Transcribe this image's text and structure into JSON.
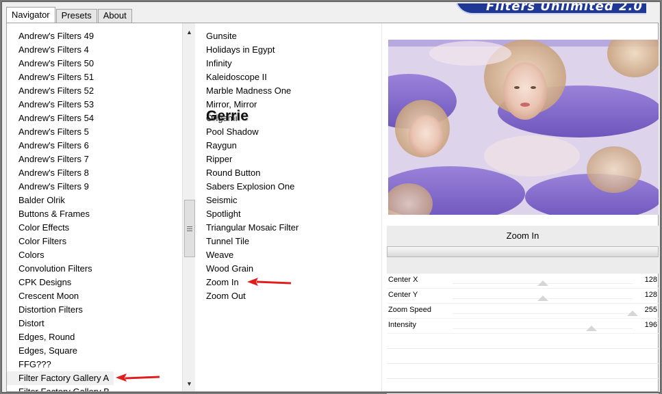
{
  "tabs": [
    {
      "label": "Navigator",
      "active": true
    },
    {
      "label": "Presets",
      "active": false
    },
    {
      "label": "About",
      "active": false
    }
  ],
  "logo_text": "Filters Unlimited 2.0",
  "category_list": {
    "items": [
      "Andrew's Filters 49",
      "Andrew's Filters 4",
      "Andrew's Filters 50",
      "Andrew's Filters 51",
      "Andrew's Filters 52",
      "Andrew's Filters 53",
      "Andrew's Filters 54",
      "Andrew's Filters 5",
      "Andrew's Filters 6",
      "Andrew's Filters 7",
      "Andrew's Filters 8",
      "Andrew's Filters 9",
      "Balder Olrik",
      "Buttons & Frames",
      "Color Effects",
      "Color Filters",
      "Colors",
      "Convolution Filters",
      "CPK Designs",
      "Crescent Moon",
      "Distortion Filters",
      "Distort",
      "Edges, Round",
      "Edges, Square",
      "FFG???",
      "Filter Factory Gallery A",
      "Filter Factory Gallery B"
    ],
    "selected": "Filter Factory Gallery A"
  },
  "filter_list": {
    "items": [
      "Gunsite",
      "Holidays in Egypt",
      "Infinity",
      "Kaleidoscope II",
      "Marble Madness One",
      "Mirror, Mirror",
      "Origami",
      "Pool Shadow",
      "Raygun",
      "Ripper",
      "Round Button",
      "Sabers Explosion One",
      "Seismic",
      "Spotlight",
      "Triangular Mosaic Filter",
      "Tunnel Tile",
      "Weave",
      "Wood Grain",
      "Zoom In",
      "Zoom Out"
    ],
    "selected": "Zoom In"
  },
  "watermark": "Gerrie",
  "selected_filter_name": "Zoom In",
  "parameters": [
    {
      "label": "Center X",
      "value": "128",
      "level": 0.5
    },
    {
      "label": "Center Y",
      "value": "128",
      "level": 0.5
    },
    {
      "label": "Zoom Speed",
      "value": "255",
      "level": 1.0
    },
    {
      "label": "Intensity",
      "value": "196",
      "level": 0.77
    }
  ],
  "colors": {
    "arrow": "#e11d1d",
    "preview_purple": "#6a4fc4",
    "logo_blue": "#1f3896"
  }
}
